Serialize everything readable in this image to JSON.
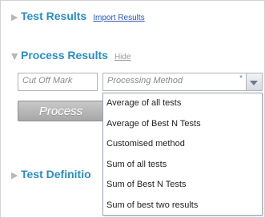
{
  "test_results": {
    "title": "Test Results",
    "link": "Import Results",
    "toggle": "▶"
  },
  "process_results": {
    "title": "Process Results",
    "link": "Hide",
    "toggle": "▼",
    "cutoff_placeholder": "Cut Off Mark",
    "method_placeholder": "Processing Method",
    "required_marker": "*",
    "process_button": "Process"
  },
  "test_definitions": {
    "title": "Test Definitio",
    "toggle": "▶"
  },
  "method_options": [
    "Average of all tests",
    "Average of Best N Tests",
    "Customised method",
    "Sum of all tests",
    "Sum of Best N Tests",
    "Sum of best two results"
  ],
  "colors": {
    "section_title": "#2a8ec2",
    "link": "#2a55b5",
    "triangle": "#b8b8b8"
  }
}
